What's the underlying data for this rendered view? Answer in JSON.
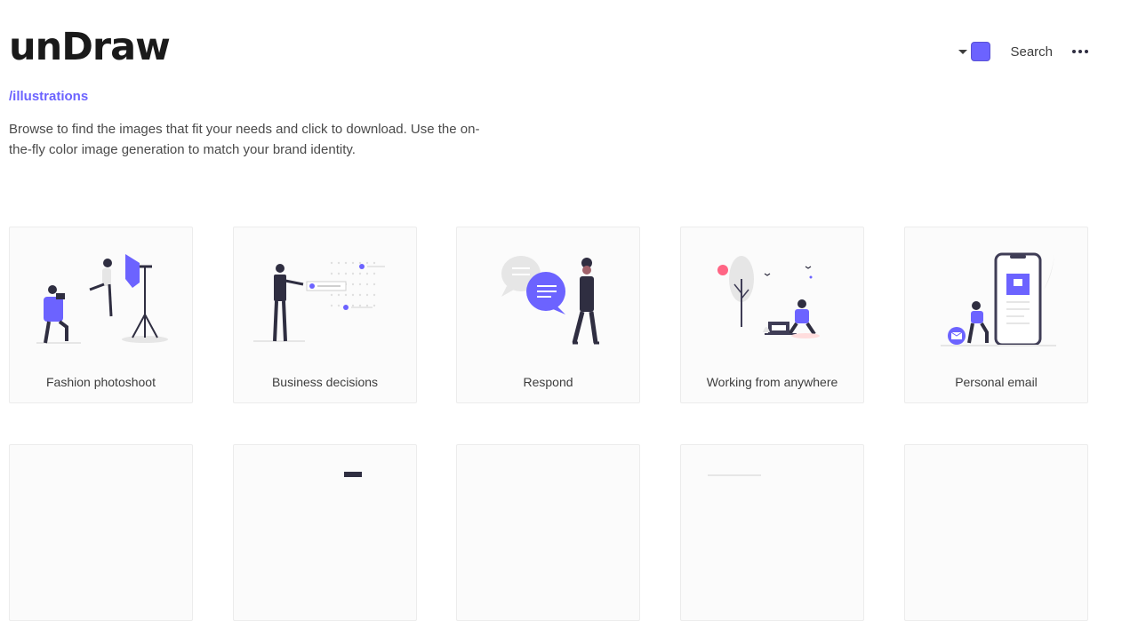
{
  "header": {
    "logo": "unDraw",
    "section_link": "/illustrations",
    "description": "Browse to find the images that fit your needs and click to download. Use the on-the-fly color image generation to match your brand identity."
  },
  "toolbar": {
    "color_hex": "#6c63ff",
    "search_label": "Search",
    "more_icon": "more-horizontal-icon"
  },
  "illustrations": [
    {
      "title": "Fashion photoshoot"
    },
    {
      "title": "Business decisions"
    },
    {
      "title": "Respond"
    },
    {
      "title": "Working from anywhere"
    },
    {
      "title": "Personal email"
    }
  ],
  "colors": {
    "accent": "#6c63ff",
    "dark": "#2f2e41",
    "card_bg": "#fbfbfb",
    "pink": "#ff6584"
  }
}
